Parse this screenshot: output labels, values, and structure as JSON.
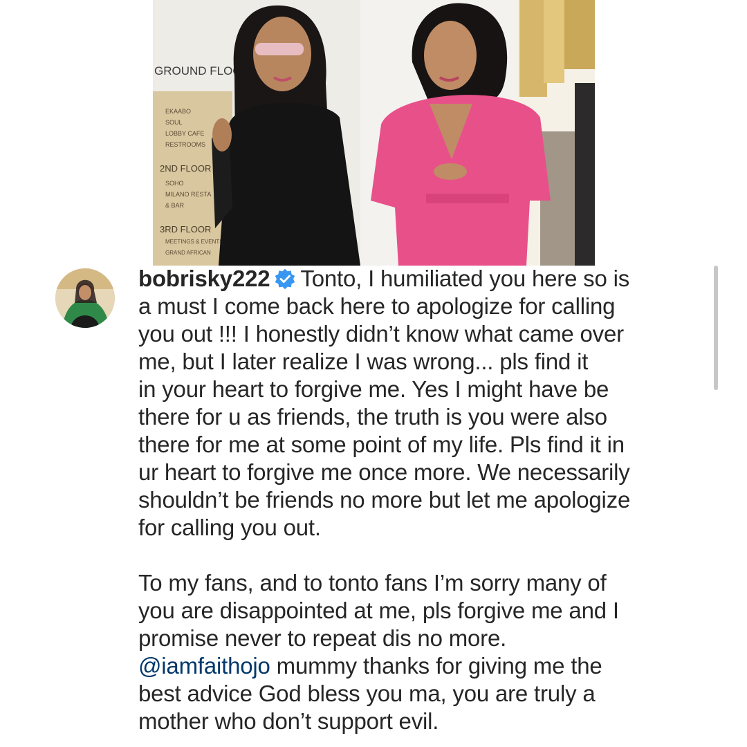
{
  "photo": {
    "sign": {
      "heading": "GROUND FLOOR",
      "group1": [
        "EKAABO",
        "SOUL",
        "LOBBY CAFE",
        "RESTROOMS"
      ],
      "floor2_heading": "2ND FLOOR",
      "group2": [
        "SOHO",
        "MILANO RESTA",
        "& BAR"
      ],
      "floor3_heading": "3RD FLOOR",
      "group3": [
        "MEETINGS & EVENTS",
        "GRAND AFRICAN"
      ]
    }
  },
  "post": {
    "username": "bobrisky222",
    "verified_icon": "verified-badge-icon",
    "lines": [
      "Tonto, I humiliated you here so is",
      "a must I come back here to apologize for calling",
      "you out !!! I honestly didn’t know what came over",
      "me, but I later realize I was wrong... pls find it",
      "in your heart to forgive me. Yes I might have be",
      "there for u as friends, the truth is you were also",
      "there for me at some point of my life. Pls find it in",
      "ur heart to forgive me once more. We necessarily",
      "shouldn’t be friends no more but let me apologize",
      "for calling you out."
    ],
    "paragraph2": [
      "To my fans, and to tonto fans I’m sorry many of",
      "you are disappointed at me, pls forgive me and I",
      "promise never to repeat dis no more."
    ],
    "mention": "@iamfaithojo",
    "mention_rest": " mummy thanks for giving me the",
    "paragraph2_tail": [
      "best advice God bless you ma, you are truly a",
      "mother who don’t support evil."
    ]
  },
  "colors": {
    "text": "#262626",
    "mention": "#00376b",
    "verified": "#3897f0",
    "pink_dress": "#e8508a"
  }
}
